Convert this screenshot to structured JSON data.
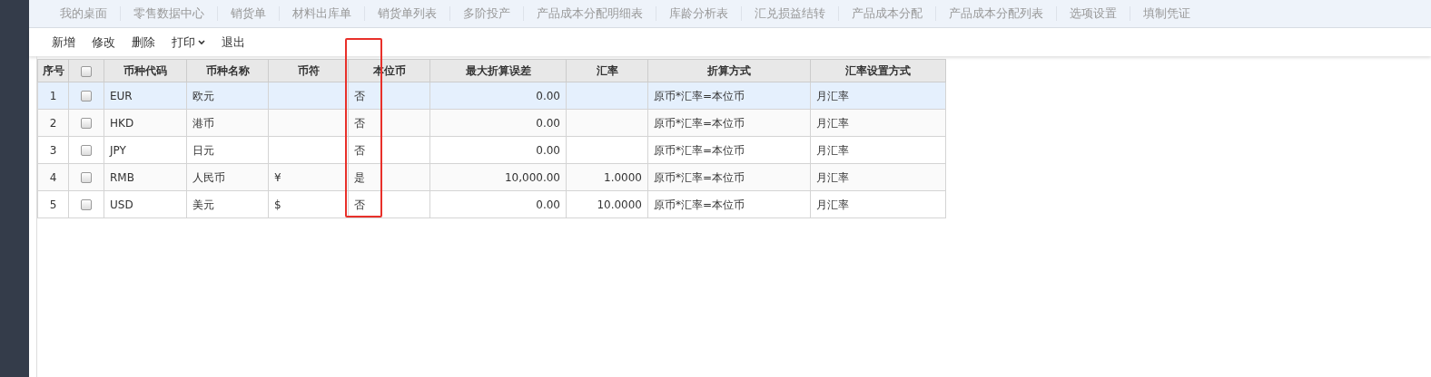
{
  "tabs": [
    {
      "label": "我的桌面",
      "selected": false
    },
    {
      "label": "零售数据中心",
      "selected": false
    },
    {
      "label": "销货单",
      "selected": false
    },
    {
      "label": "材料出库单",
      "selected": false
    },
    {
      "label": "销货单列表",
      "selected": false
    },
    {
      "label": "多阶投产",
      "selected": false
    },
    {
      "label": "产品成本分配明细表",
      "selected": false
    },
    {
      "label": "库龄分析表",
      "selected": false
    },
    {
      "label": "汇兑损益结转",
      "selected": false
    },
    {
      "label": "产品成本分配",
      "selected": false
    },
    {
      "label": "产品成本分配列表",
      "selected": false
    },
    {
      "label": "选项设置",
      "selected": false
    },
    {
      "label": "填制凭证",
      "selected": false
    }
  ],
  "toolbar": [
    {
      "label": "新增",
      "kind": "plain"
    },
    {
      "label": "修改",
      "kind": "plain"
    },
    {
      "label": "删除",
      "kind": "plain"
    },
    {
      "label": "打印",
      "kind": "dropdown"
    },
    {
      "label": "退出",
      "kind": "plain"
    }
  ],
  "table": {
    "columns": [
      "序号",
      "币种代码",
      "币种名称",
      "币符",
      "本位币",
      "最大折算误差",
      "汇率",
      "折算方式",
      "汇率设置方式"
    ],
    "header_checked": false,
    "rows": [
      {
        "selected": true,
        "checked": false,
        "cells": [
          "1",
          "EUR",
          "欧元",
          "",
          "否",
          "0.00",
          "",
          "原币*汇率=本位币",
          "月汇率"
        ]
      },
      {
        "selected": false,
        "checked": false,
        "cells": [
          "2",
          "HKD",
          "港币",
          "",
          "否",
          "0.00",
          "",
          "原币*汇率=本位币",
          "月汇率"
        ]
      },
      {
        "selected": false,
        "checked": false,
        "cells": [
          "3",
          "JPY",
          "日元",
          "",
          "否",
          "0.00",
          "",
          "原币*汇率=本位币",
          "月汇率"
        ]
      },
      {
        "selected": false,
        "checked": false,
        "cells": [
          "4",
          "RMB",
          "人民币",
          "¥",
          "是",
          "10,000.00",
          "1.0000",
          "原币*汇率=本位币",
          "月汇率"
        ]
      },
      {
        "selected": false,
        "checked": false,
        "cells": [
          "5",
          "USD",
          "美元",
          "$",
          "否",
          "0.00",
          "10.0000",
          "原币*汇率=本位币",
          "月汇率"
        ]
      }
    ]
  }
}
